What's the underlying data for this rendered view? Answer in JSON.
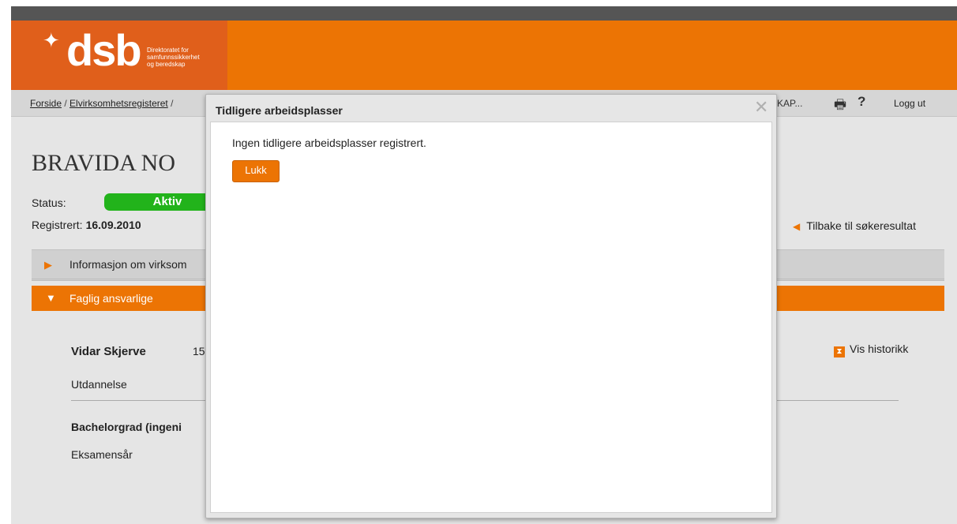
{
  "header": {
    "logo_text": "dsb",
    "logo_tagline": [
      "Direktoratet for",
      "samfunnssikkerhet",
      "og beredskap"
    ]
  },
  "breadcrumb": {
    "items": [
      "Forside",
      "Elvirksomhetsregisteret"
    ],
    "separator": "/",
    "truncated_right": "KAP..."
  },
  "toolbar": {
    "logout": "Logg ut",
    "help": "?"
  },
  "page": {
    "company_name": "BRAVIDA NO",
    "status_label": "Status:",
    "status_value": "Aktiv",
    "registered_label": "Registrert:",
    "registered_value": "16.09.2010",
    "back_link": "Tilbake til søkeresultat"
  },
  "sections": {
    "info_label": "Informasjon om virksom",
    "faglig_label": "Faglig ansvarlige"
  },
  "person": {
    "name": "Vidar Skjerve",
    "number": "15",
    "history_link": "Vis historikk",
    "education_label": "Utdannelse",
    "degree": "Bachelorgrad (ingeni",
    "exam_year_label": "Eksamensår"
  },
  "dialog": {
    "title": "Tidligere arbeidsplasser",
    "message": "Ingen tidligere arbeidsplasser registrert.",
    "close_button": "Lukk",
    "close_glyph": "✕"
  },
  "colors": {
    "brand_orange": "#ec7404",
    "logo_orange": "#e05f1b",
    "status_green": "#22b31b",
    "topbar": "#555555"
  }
}
